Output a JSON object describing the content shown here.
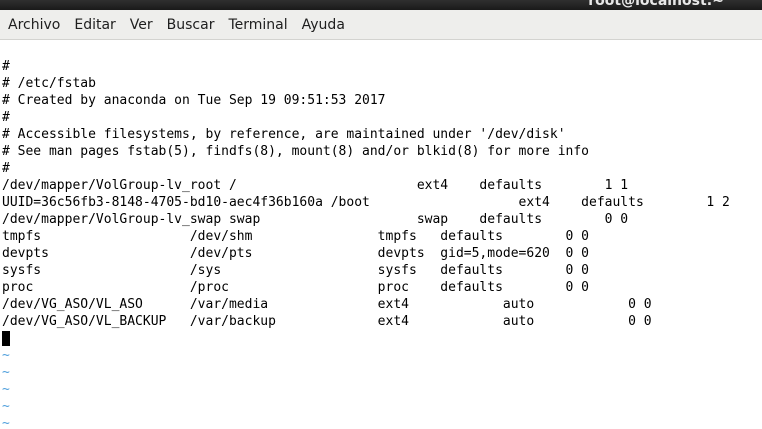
{
  "window": {
    "title": "root@localhost:~",
    "colors": {
      "titlebar": "#1a1a1a",
      "menubar": "#eeeeec",
      "background": "#ffffff",
      "text": "#000000",
      "tilde": "#4f9fdc"
    }
  },
  "menu": {
    "items": [
      "Archivo",
      "Editar",
      "Ver",
      "Buscar",
      "Terminal",
      "Ayuda"
    ]
  },
  "editor": {
    "lines": [
      "#",
      "# /etc/fstab",
      "# Created by anaconda on Tue Sep 19 09:51:53 2017",
      "#",
      "# Accessible filesystems, by reference, are maintained under '/dev/disk'",
      "# See man pages fstab(5), findfs(8), mount(8) and/or blkid(8) for more info",
      "#",
      "/dev/mapper/VolGroup-lv_root /                       ext4    defaults        1 1",
      "UUID=36c56fb3-8148-4705-bd10-aec4f36b160a /boot                   ext4    defaults        1 2",
      "/dev/mapper/VolGroup-lv_swap swap                    swap    defaults        0 0",
      "tmpfs                   /dev/shm                tmpfs   defaults        0 0",
      "devpts                  /dev/pts                devpts  gid=5,mode=620  0 0",
      "sysfs                   /sys                    sysfs   defaults        0 0",
      "proc                    /proc                   proc    defaults        0 0",
      "/dev/VG_ASO/VL_ASO      /var/media              ext4            auto            0 0",
      "/dev/VG_ASO/VL_BACKUP   /var/backup             ext4            auto            0 0"
    ],
    "tilde_lines": [
      "~",
      "~",
      "~",
      "~",
      "~"
    ]
  }
}
